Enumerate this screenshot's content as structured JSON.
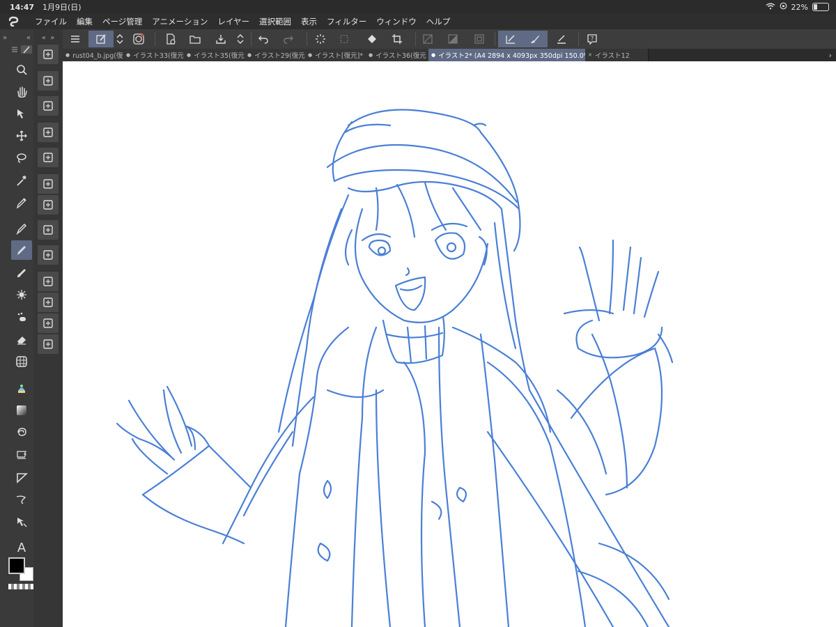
{
  "status": {
    "time": "14:47",
    "date": "1月9日(日)",
    "battery": "22%",
    "battery_level": 0.22
  },
  "menu": [
    "ファイル",
    "編集",
    "ページ管理",
    "アニメーション",
    "レイヤー",
    "選択範囲",
    "表示",
    "フィルター",
    "ウィンドウ",
    "ヘルプ"
  ],
  "tabs": [
    "rust04_b.jpg(復",
    "イラスト33(復元",
    "イラスト35(復元",
    "イラスト29(復元",
    "イラスト[復元]*",
    "イラスト36(復元",
    "イラスト2* (A4 2894 x 4093px 350dpi 150.0%)",
    "イラスト12"
  ],
  "active_tab_index": 6,
  "colors": {
    "main_color": "#000000",
    "sub_color": "#ffffff",
    "sketch_line": "#4a7fd6",
    "accent": "#5f6a85"
  },
  "tools_icons": [
    "zoom-icon",
    "hand-icon",
    "operation-icon",
    "move-icon",
    "lasso-icon",
    "magic-wand-icon",
    "eyedropper-icon",
    "pen-icon",
    "pencil-icon",
    "brush-icon",
    "airbrush-icon",
    "decoration-icon",
    "eraser-icon",
    "perspective-icon",
    "fill-icon",
    "gradient-icon",
    "figure-icon",
    "frame-icon",
    "ruler-icon",
    "correct-line-icon",
    "object-icon",
    "text-icon"
  ],
  "text_tool_label": "A"
}
